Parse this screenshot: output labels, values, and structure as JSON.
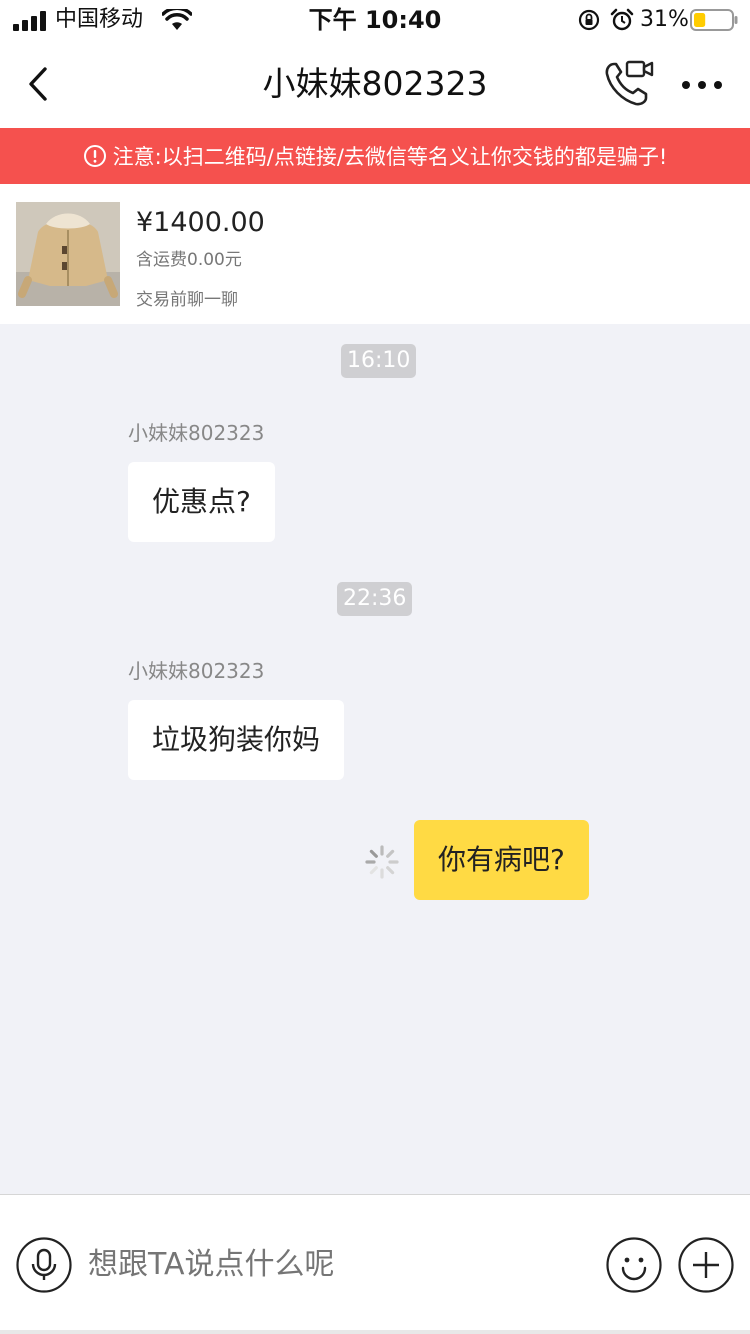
{
  "status_bar": {
    "carrier": "中国移动",
    "time": "下午 10:40",
    "battery_percent": "31%",
    "battery_level": 0.31,
    "icons": [
      "signal-icon",
      "wifi-icon",
      "rotation-lock-icon",
      "alarm-icon",
      "battery-icon"
    ]
  },
  "nav": {
    "title": "小妹妹802323",
    "icons": [
      "back-icon",
      "video-call-icon",
      "more-icon"
    ]
  },
  "warning": {
    "text": "注意:以扫二维码/点链接/去微信等名义让你交钱的都是骗子!",
    "icon": "alert-circle-icon"
  },
  "product": {
    "price": "¥1400.00",
    "shipping": "含运费0.00元",
    "hint": "交易前聊一聊"
  },
  "chat": {
    "messages": [
      {
        "time": "16:10",
        "sender": "小妹妹802323",
        "text": "优惠点?",
        "direction": "in"
      },
      {
        "time": "22:36",
        "sender": "小妹妹802323",
        "text": "垃圾狗装你妈",
        "direction": "in"
      },
      {
        "text": "你有病吧?",
        "direction": "out",
        "status": "sending"
      }
    ]
  },
  "input": {
    "placeholder": "想跟TA说点什么呢",
    "icons": [
      "microphone-icon",
      "emoji-icon",
      "plus-icon"
    ]
  },
  "colors": {
    "warning_bg": "#f5514e",
    "chat_bg": "#f1f2f7",
    "outgoing_bubble": "#ffda44",
    "incoming_bubble": "#ffffff"
  }
}
